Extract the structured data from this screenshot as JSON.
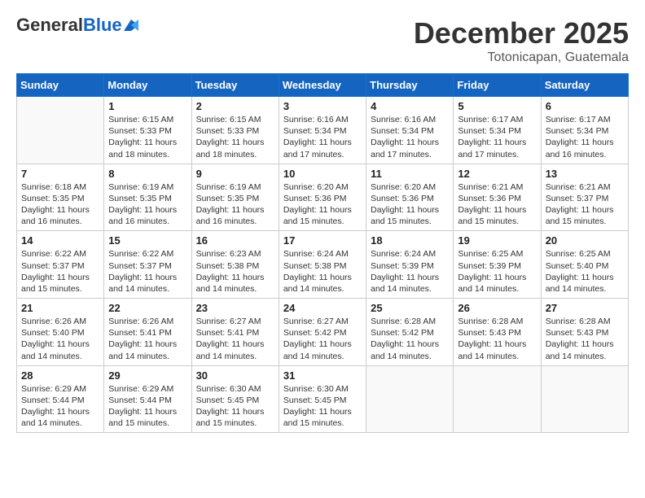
{
  "header": {
    "logo_general": "General",
    "logo_blue": "Blue",
    "month_year": "December 2025",
    "location": "Totonicapan, Guatemala"
  },
  "weekdays": [
    "Sunday",
    "Monday",
    "Tuesday",
    "Wednesday",
    "Thursday",
    "Friday",
    "Saturday"
  ],
  "weeks": [
    [
      {
        "day": "",
        "info": ""
      },
      {
        "day": "1",
        "info": "Sunrise: 6:15 AM\nSunset: 5:33 PM\nDaylight: 11 hours and 18 minutes."
      },
      {
        "day": "2",
        "info": "Sunrise: 6:15 AM\nSunset: 5:33 PM\nDaylight: 11 hours and 18 minutes."
      },
      {
        "day": "3",
        "info": "Sunrise: 6:16 AM\nSunset: 5:34 PM\nDaylight: 11 hours and 17 minutes."
      },
      {
        "day": "4",
        "info": "Sunrise: 6:16 AM\nSunset: 5:34 PM\nDaylight: 11 hours and 17 minutes."
      },
      {
        "day": "5",
        "info": "Sunrise: 6:17 AM\nSunset: 5:34 PM\nDaylight: 11 hours and 17 minutes."
      },
      {
        "day": "6",
        "info": "Sunrise: 6:17 AM\nSunset: 5:34 PM\nDaylight: 11 hours and 16 minutes."
      }
    ],
    [
      {
        "day": "7",
        "info": "Sunrise: 6:18 AM\nSunset: 5:35 PM\nDaylight: 11 hours and 16 minutes."
      },
      {
        "day": "8",
        "info": "Sunrise: 6:19 AM\nSunset: 5:35 PM\nDaylight: 11 hours and 16 minutes."
      },
      {
        "day": "9",
        "info": "Sunrise: 6:19 AM\nSunset: 5:35 PM\nDaylight: 11 hours and 16 minutes."
      },
      {
        "day": "10",
        "info": "Sunrise: 6:20 AM\nSunset: 5:36 PM\nDaylight: 11 hours and 15 minutes."
      },
      {
        "day": "11",
        "info": "Sunrise: 6:20 AM\nSunset: 5:36 PM\nDaylight: 11 hours and 15 minutes."
      },
      {
        "day": "12",
        "info": "Sunrise: 6:21 AM\nSunset: 5:36 PM\nDaylight: 11 hours and 15 minutes."
      },
      {
        "day": "13",
        "info": "Sunrise: 6:21 AM\nSunset: 5:37 PM\nDaylight: 11 hours and 15 minutes."
      }
    ],
    [
      {
        "day": "14",
        "info": "Sunrise: 6:22 AM\nSunset: 5:37 PM\nDaylight: 11 hours and 15 minutes."
      },
      {
        "day": "15",
        "info": "Sunrise: 6:22 AM\nSunset: 5:37 PM\nDaylight: 11 hours and 14 minutes."
      },
      {
        "day": "16",
        "info": "Sunrise: 6:23 AM\nSunset: 5:38 PM\nDaylight: 11 hours and 14 minutes."
      },
      {
        "day": "17",
        "info": "Sunrise: 6:24 AM\nSunset: 5:38 PM\nDaylight: 11 hours and 14 minutes."
      },
      {
        "day": "18",
        "info": "Sunrise: 6:24 AM\nSunset: 5:39 PM\nDaylight: 11 hours and 14 minutes."
      },
      {
        "day": "19",
        "info": "Sunrise: 6:25 AM\nSunset: 5:39 PM\nDaylight: 11 hours and 14 minutes."
      },
      {
        "day": "20",
        "info": "Sunrise: 6:25 AM\nSunset: 5:40 PM\nDaylight: 11 hours and 14 minutes."
      }
    ],
    [
      {
        "day": "21",
        "info": "Sunrise: 6:26 AM\nSunset: 5:40 PM\nDaylight: 11 hours and 14 minutes."
      },
      {
        "day": "22",
        "info": "Sunrise: 6:26 AM\nSunset: 5:41 PM\nDaylight: 11 hours and 14 minutes."
      },
      {
        "day": "23",
        "info": "Sunrise: 6:27 AM\nSunset: 5:41 PM\nDaylight: 11 hours and 14 minutes."
      },
      {
        "day": "24",
        "info": "Sunrise: 6:27 AM\nSunset: 5:42 PM\nDaylight: 11 hours and 14 minutes."
      },
      {
        "day": "25",
        "info": "Sunrise: 6:28 AM\nSunset: 5:42 PM\nDaylight: 11 hours and 14 minutes."
      },
      {
        "day": "26",
        "info": "Sunrise: 6:28 AM\nSunset: 5:43 PM\nDaylight: 11 hours and 14 minutes."
      },
      {
        "day": "27",
        "info": "Sunrise: 6:28 AM\nSunset: 5:43 PM\nDaylight: 11 hours and 14 minutes."
      }
    ],
    [
      {
        "day": "28",
        "info": "Sunrise: 6:29 AM\nSunset: 5:44 PM\nDaylight: 11 hours and 14 minutes."
      },
      {
        "day": "29",
        "info": "Sunrise: 6:29 AM\nSunset: 5:44 PM\nDaylight: 11 hours and 15 minutes."
      },
      {
        "day": "30",
        "info": "Sunrise: 6:30 AM\nSunset: 5:45 PM\nDaylight: 11 hours and 15 minutes."
      },
      {
        "day": "31",
        "info": "Sunrise: 6:30 AM\nSunset: 5:45 PM\nDaylight: 11 hours and 15 minutes."
      },
      {
        "day": "",
        "info": ""
      },
      {
        "day": "",
        "info": ""
      },
      {
        "day": "",
        "info": ""
      }
    ]
  ]
}
